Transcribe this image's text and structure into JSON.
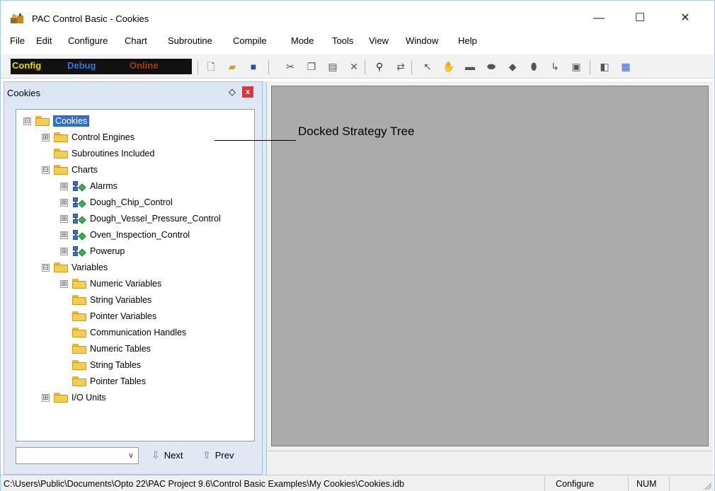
{
  "window": {
    "title": "PAC Control Basic - Cookies",
    "minimize": "—",
    "maximize": "☐",
    "close": "✕"
  },
  "menu": [
    "File",
    "Edit",
    "Configure",
    "Chart",
    "Subroutine",
    "Compile",
    "Mode",
    "Tools",
    "View",
    "Window",
    "Help"
  ],
  "toolbar": {
    "modes": {
      "config": "Config",
      "debug": "Debug",
      "online": "Online"
    }
  },
  "panel": {
    "title": "Cookies",
    "pin": "◇",
    "close": "x"
  },
  "tree": [
    {
      "label": "Cookies",
      "icon": "folder",
      "expander": "⊟",
      "selected": true
    },
    {
      "label": "Control Engines",
      "icon": "folder",
      "expander": "⊞"
    },
    {
      "label": "Subroutines Included",
      "icon": "folder",
      "expander": ""
    },
    {
      "label": "Charts",
      "icon": "folder",
      "expander": "⊟"
    },
    {
      "label": "Alarms",
      "icon": "chart",
      "expander": "⊞"
    },
    {
      "label": "Dough_Chip_Control",
      "icon": "chart",
      "expander": "⊞"
    },
    {
      "label": "Dough_Vessel_Pressure_Control",
      "icon": "chart",
      "expander": "⊞"
    },
    {
      "label": "Oven_Inspection_Control",
      "icon": "chart",
      "expander": "⊞"
    },
    {
      "label": "Powerup",
      "icon": "chart",
      "expander": "⊞"
    },
    {
      "label": "Variables",
      "icon": "folder",
      "expander": "⊟"
    },
    {
      "label": "Numeric Variables",
      "icon": "folder",
      "expander": "⊞"
    },
    {
      "label": "String Variables",
      "icon": "folder",
      "expander": ""
    },
    {
      "label": "Pointer Variables",
      "icon": "folder",
      "expander": ""
    },
    {
      "label": "Communication Handles",
      "icon": "folder",
      "expander": ""
    },
    {
      "label": "Numeric Tables",
      "icon": "folder",
      "expander": ""
    },
    {
      "label": "String Tables",
      "icon": "folder",
      "expander": ""
    },
    {
      "label": "Pointer Tables",
      "icon": "folder",
      "expander": ""
    },
    {
      "label": "I/O Units",
      "icon": "folder",
      "expander": "⊞"
    }
  ],
  "navigation": {
    "dropdown_value": "",
    "next": "Next",
    "prev": "Prev"
  },
  "callout": "Docked Strategy Tree",
  "status": {
    "path": "C:\\Users\\Public\\Documents\\Opto 22\\PAC Project 9.6\\Control Basic Examples\\My Cookies\\Cookies.idb",
    "mode": "Configure",
    "num": "NUM"
  },
  "colors": {
    "workspace": "#ababab",
    "panel": "#dfe8f3",
    "selection": "#2f6fd0",
    "folder": "#f3cd55",
    "close_red": "#d9363e"
  }
}
